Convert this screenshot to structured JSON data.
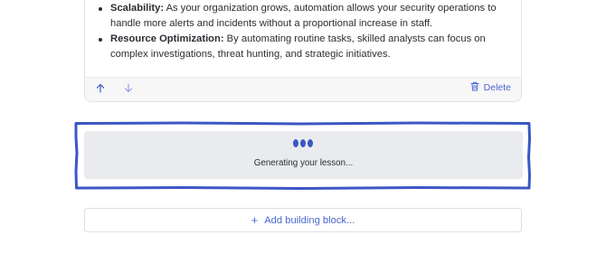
{
  "content_card": {
    "bullets": [
      {
        "term": "Scalability:",
        "text": " As your organization grows, automation allows your security operations to handle more alerts and incidents without a proportional increase in staff."
      },
      {
        "term": "Resource Optimization:",
        "text": " By automating routine tasks, skilled analysts can focus on complex investigations, threat hunting, and strategic initiatives."
      }
    ],
    "toolbar": {
      "move_up_icon": "arrow-up-icon",
      "move_down_icon": "arrow-down-icon",
      "delete_label": "Delete",
      "delete_icon": "trash-icon"
    }
  },
  "generating": {
    "status_text": "Generating your lesson...",
    "loader_icon": "loading-dots-icon",
    "highlight_color": "#3a57c4"
  },
  "add_block": {
    "label": "Add building block...",
    "icon": "plus-icon"
  },
  "colors": {
    "accent": "#4a67cf",
    "panel_bg": "#e9ebee",
    "card_bg": "#f7f7f8"
  }
}
